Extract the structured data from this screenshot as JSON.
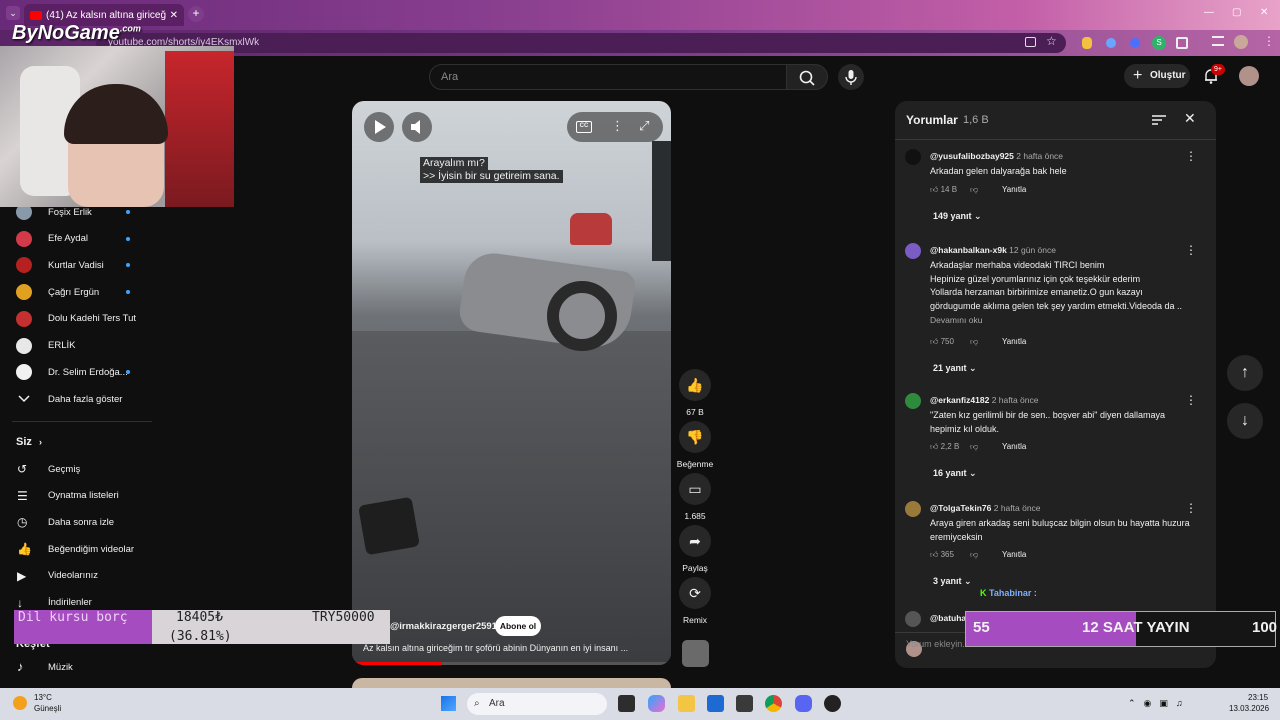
{
  "browser": {
    "tab_title": "(41) Az kalsın altına giriceğim tı",
    "url": "youtube.com/shorts/iy4EKsmxlWk"
  },
  "overlay": {
    "logo_text": "ByNoGame",
    "logo_sup": ".com",
    "donation_text": "Dil kursu borç",
    "donation_amount": "18405₺",
    "donation_percent": "(36.81%)",
    "donation_goal": "TRY50000",
    "donation_progress": 0.3681,
    "chat_user": "Tahabinar :",
    "goal_left": "55",
    "goal_title": "12 SAAT YAYIN",
    "goal_right": "100"
  },
  "header": {
    "search_placeholder": "Ara",
    "create_label": "Oluştur",
    "notif_count": "9+"
  },
  "sidebar": {
    "subscriptions": [
      {
        "label": "Foşix Erlik",
        "color": "#8899aa",
        "dot": true
      },
      {
        "label": "Efe Aydal",
        "color": "#d23a4a",
        "dot": true
      },
      {
        "label": "Kurtlar Vadisi",
        "color": "#b52020",
        "dot": true
      },
      {
        "label": "Çağrı Ergün",
        "color": "#e0a020",
        "dot": true
      },
      {
        "label": "Dolu Kadehi Ters Tut",
        "color": "#c23030",
        "dot": false
      },
      {
        "label": "ERLİK",
        "color": "#e8e8e8",
        "dot": false
      },
      {
        "label": "Dr. Selim Erdoğa...",
        "color": "#f1f1f1",
        "dot": true
      }
    ],
    "show_more": "Daha fazla göster",
    "you_title": "Siz",
    "you_items": [
      "Geçmiş",
      "Oynatma listeleri",
      "Daha sonra izle",
      "Beğendiğim videolar",
      "Videolarınız",
      "İndirilenler"
    ],
    "explore_title": "Keşfet",
    "explore_items": [
      "Müzik"
    ]
  },
  "video": {
    "subtitle_line1": "Arayalım mı?",
    "subtitle_line2": ">> İyisin bir su getireim sana.",
    "channel": "@irmakkirazgerger2591",
    "subscribe": "Abone ol",
    "title": "Az kalsın altına giriceğim tır şoförü abinin Dünyanın en iyi insanı ..."
  },
  "actions": {
    "likes": "67 B",
    "dislike": "Beğenme",
    "comments": "1.685",
    "share": "Paylaş",
    "remix": "Remix"
  },
  "comments": {
    "title": "Yorumlar",
    "count": "1,6 B",
    "reply_label": "Yanıtla",
    "more_label": "Devamını oku",
    "add_placeholder": "Yorum ekleyin...",
    "items": [
      {
        "author": "@yusufalibozbay925",
        "time": "2 hafta önce",
        "text": "Arkadan gelen dalyarağa bak hele",
        "likes": "14 B",
        "replies": "149 yanıt",
        "color": "#111111"
      },
      {
        "author": "@hakanbalkan-x9k",
        "time": "12 gün önce",
        "text": "Arkadaşlar  merhaba videodaki TIRCI benim\nHepinize güzel yorumlarınız için çok teşekkür ederim\nYollarda herzaman birbirimize emanetiz.O gun kazayı\ngördugumde aklıma gelen tek şey yardım etmekti.Videoda da ..",
        "likes": "750",
        "replies": "21 yanıt",
        "color": "#7b5cc4"
      },
      {
        "author": "@erkanfiz4182",
        "time": "2 hafta önce",
        "text": "\"Zaten kız gerilimli bir de sen.. boşver abi\" diyen dallamaya\nhepimiz kıl olduk.",
        "likes": "2,2 B",
        "replies": "16 yanıt",
        "color": "#2e8b3e"
      },
      {
        "author": "@TolgaTekin76",
        "time": "2 hafta önce",
        "text": "Araya giren arkadaş seni buluşcaz bilgin olsun bu hayatta huzura\neremiyceksin",
        "likes": "365",
        "replies": "3 yanıt",
        "color": "#9a7a3a"
      },
      {
        "author": "@batuhan",
        "time": "",
        "text": "",
        "likes": "",
        "replies": "",
        "color": "#555555"
      }
    ]
  },
  "taskbar": {
    "weather_temp": "13°C",
    "weather_desc": "Güneşli",
    "search": "Ara",
    "time": "23:15",
    "date": "13.03.2026"
  }
}
